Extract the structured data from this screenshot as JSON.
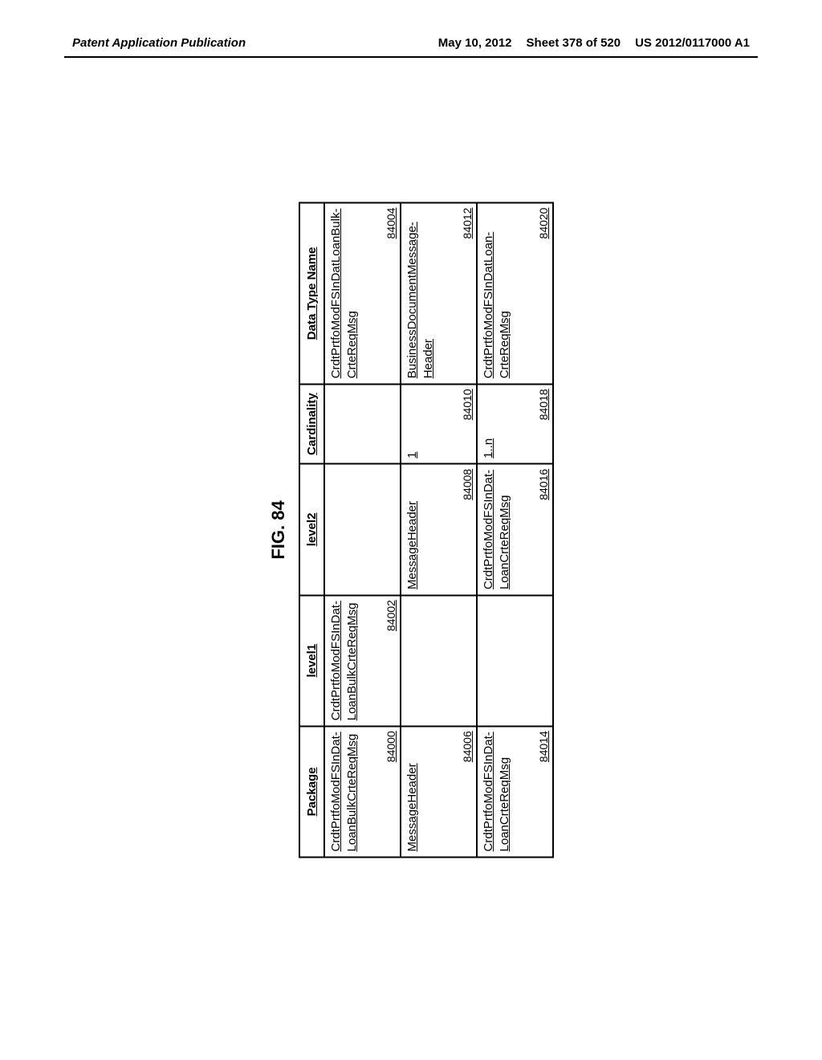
{
  "header": {
    "left": "Patent Application Publication",
    "date": "May 10, 2012",
    "sheet": "Sheet 378 of 520",
    "pubno": "US 2012/0117000 A1"
  },
  "figure": {
    "title": "FIG. 84",
    "headers": {
      "package": "Package",
      "level1": "level1",
      "level2": "level2",
      "cardinality": "Cardinality",
      "datatype": "Data Type Name"
    },
    "rows": [
      {
        "package": {
          "text": "CrdtPrtfoModFSInDat-LoanBulkCrteReqMsg",
          "ref": "84000"
        },
        "level1": {
          "text": "CrdtPrtfoModFSInDat-LoanBulkCrteReqMsg",
          "ref": "84002"
        },
        "level2": {
          "text": "",
          "ref": ""
        },
        "cardinality": {
          "text": "",
          "ref": ""
        },
        "datatype": {
          "text": "CrdtPrtfoModFSInDatLoanBulk-CrteReqMsg",
          "ref": "84004"
        }
      },
      {
        "package": {
          "text": "MessageHeader",
          "ref": "84006"
        },
        "level1": {
          "text": "",
          "ref": ""
        },
        "level2": {
          "text": "MessageHeader",
          "ref": "84008"
        },
        "cardinality": {
          "text": "1",
          "ref": "84010"
        },
        "datatype": {
          "text": "BusinessDocumentMessage-Header",
          "ref": "84012"
        }
      },
      {
        "package": {
          "text": "CrdtPrtfoModFSInDat-LoanCrteReqMsg",
          "ref": "84014"
        },
        "level1": {
          "text": "",
          "ref": ""
        },
        "level2": {
          "text": "CrdtPrtfoModFSInDat-LoanCrteReqMsg",
          "ref": "84016"
        },
        "cardinality": {
          "text": "1..n",
          "ref": "84018"
        },
        "datatype": {
          "text": "CrdtPrtfoModFSInDatLoan-CrteReqMsg",
          "ref": "84020"
        }
      }
    ]
  }
}
